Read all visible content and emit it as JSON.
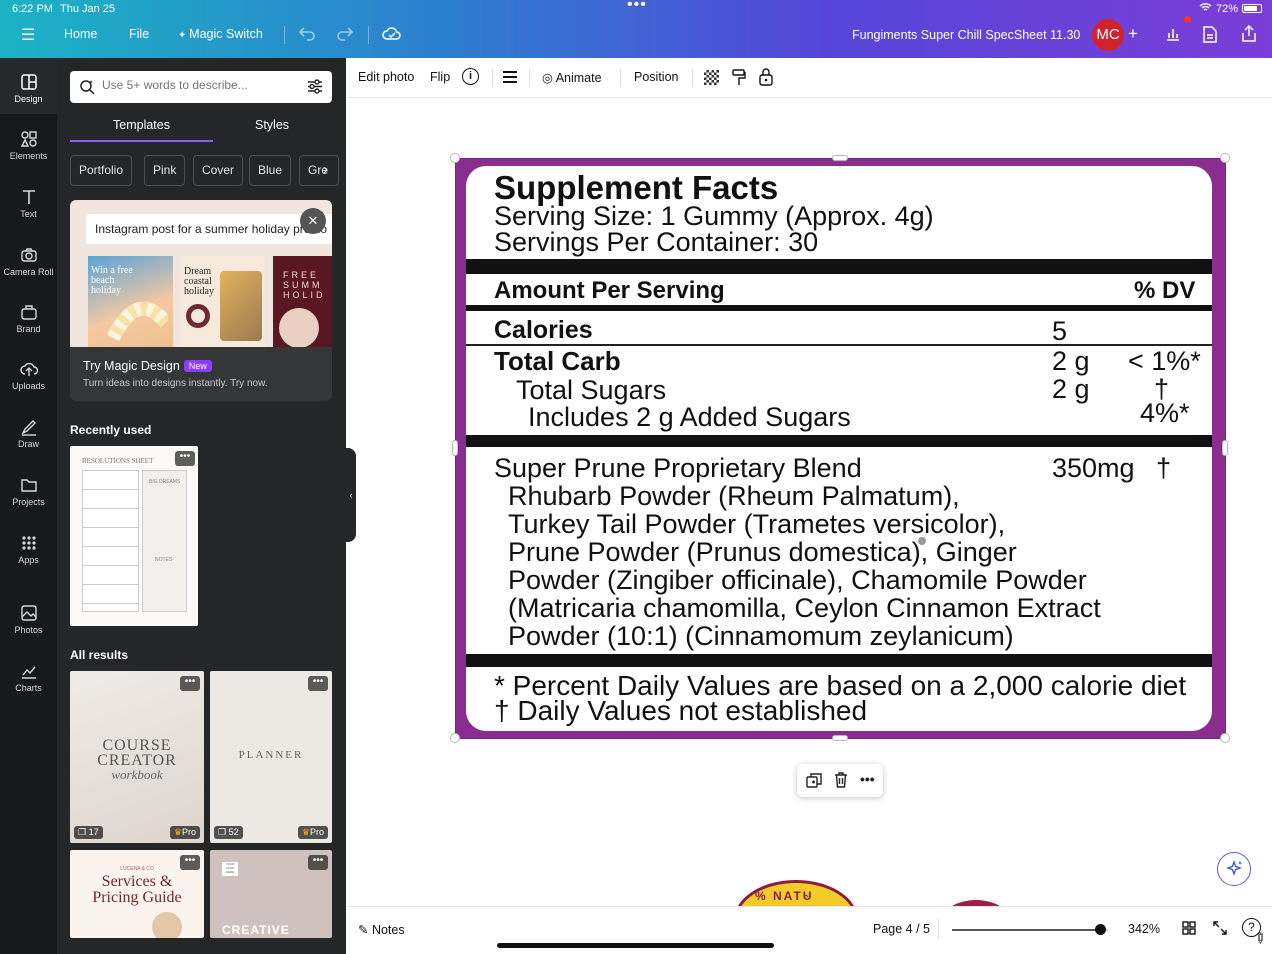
{
  "status": {
    "time": "6:22 PM",
    "date": "Thu Jan 25",
    "battery": "72%"
  },
  "header": {
    "home": "Home",
    "file": "File",
    "magic_switch": "Magic Switch",
    "doc_title": "Fungiments Super Chill SpecSheet 11.30",
    "avatar": "MC",
    "gradient": [
      "#1bb3c4",
      "#7b3ed8"
    ]
  },
  "rail": {
    "design": "Design",
    "elements": "Elements",
    "text": "Text",
    "camera_roll": "Camera Roll",
    "brand": "Brand",
    "uploads": "Uploads",
    "draw": "Draw",
    "projects": "Projects",
    "apps": "Apps",
    "photos": "Photos",
    "charts": "Charts"
  },
  "panel": {
    "search_placeholder": "Use 5+ words to describe...",
    "tabs": [
      "Templates",
      "Styles"
    ],
    "chips": [
      "Portfolio",
      "Pink",
      "Cover",
      "Blue",
      "Gre"
    ],
    "magic": {
      "prompt": "Instagram post for a summer holiday promo",
      "title": "Try Magic Design",
      "badge": "New",
      "subtitle": "Turn ideas into designs instantly. Try now.",
      "tile1": "Win a free beach holiday",
      "tile2": "Dream coastal holiday",
      "tile3": "FREE SUMM HOLID"
    },
    "recently_used": "Recently used",
    "recent_thumb": {
      "title": "RESOLUTIONS SHEET",
      "big_dreams": "BIG DREAMS",
      "notes": "NOTES"
    },
    "all_results": "All results",
    "results": [
      {
        "title1": "COURSE",
        "title2": "CREATOR",
        "title3": "workbook",
        "pages": "17",
        "pro": "Pro"
      },
      {
        "title1": "PLANNER",
        "pages": "52",
        "pro": "Pro"
      },
      {
        "title1": "Services &",
        "title2": "Pricing Guide",
        "kicker": "LUCENA & CO"
      },
      {
        "title1": "CREATIVE",
        "kicker": "YOUR LOGO HERE"
      }
    ]
  },
  "toolbar": {
    "edit_photo": "Edit photo",
    "flip": "Flip",
    "animate": "Animate",
    "position": "Position"
  },
  "label": {
    "title": "Supplement Facts",
    "serving_size": "Serving Size: 1 Gummy (Approx. 4g)",
    "servings_per": "Servings Per Container: 30",
    "amount_per": "Amount Per Serving",
    "dv": "% DV",
    "calories": "Calories",
    "calories_val": "5",
    "total_carb": "Total Carb",
    "total_carb_val": "2 g",
    "total_carb_dv": "< 1%*",
    "total_sugars": "Total Sugars",
    "total_sugars_val": "2 g",
    "total_sugars_dv": "†",
    "added_sugars": "Includes 2 g Added Sugars",
    "added_sugars_dv": "4%*",
    "blend": "Super Prune Proprietary Blend",
    "blend_val": "350mg",
    "blend_dv": "†",
    "ingredients": [
      "Rhubarb Powder (Rheum Palmatum),",
      "Turkey Tail Powder (Trametes versicolor),",
      "Prune Powder (Prunus domestica), Ginger",
      "Powder (Zingiber officinale), Chamomile Powder",
      "(Matricaria chamomilla, Ceylon Cinnamon Extract",
      "Powder (10:1) (Cinnamomum zeylanicum)"
    ],
    "footnote1": "* Percent Daily Values are based on a 2,000 calorie diet",
    "footnote2": "† Daily Values not established",
    "frame_color": "#8a2d8f"
  },
  "footer": {
    "notes": "Notes",
    "page": "Page 4 / 5",
    "zoom": "342%",
    "zoom_level": 0.95
  },
  "bottom_art": {
    "text": "% NATU"
  }
}
